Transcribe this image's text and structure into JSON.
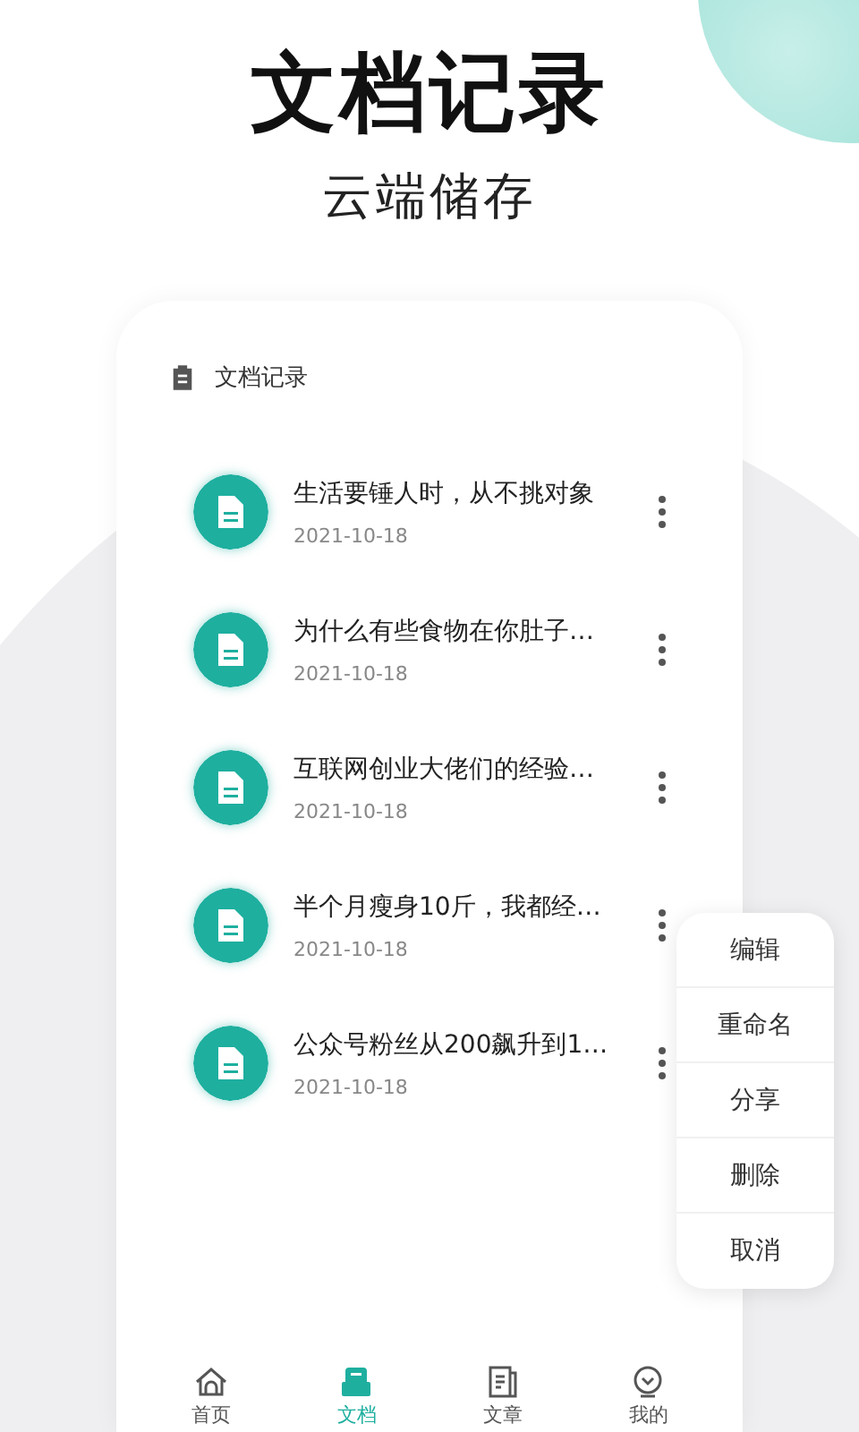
{
  "heading": "文档记录",
  "subheading": "云端储存",
  "card": {
    "title": "文档记录",
    "documents": [
      {
        "title": "生活要锤人时，从不挑对象",
        "date": "2021-10-18"
      },
      {
        "title": "为什么有些食物在你肚子…",
        "date": "2021-10-18"
      },
      {
        "title": "互联网创业大佬们的经验…",
        "date": "2021-10-18"
      },
      {
        "title": "半个月瘦身10斤，我都经…",
        "date": "2021-10-18"
      },
      {
        "title": "公众号粉丝从200飙升到1…",
        "date": "2021-10-18"
      }
    ]
  },
  "context_menu": [
    "编辑",
    "重命名",
    "分享",
    "删除",
    "取消"
  ],
  "tabs": [
    {
      "label": "首页",
      "kind": "home",
      "selected": false
    },
    {
      "label": "文档",
      "kind": "docs",
      "selected": true
    },
    {
      "label": "文章",
      "kind": "articles",
      "selected": false
    },
    {
      "label": "我的",
      "kind": "profile",
      "selected": false
    }
  ]
}
